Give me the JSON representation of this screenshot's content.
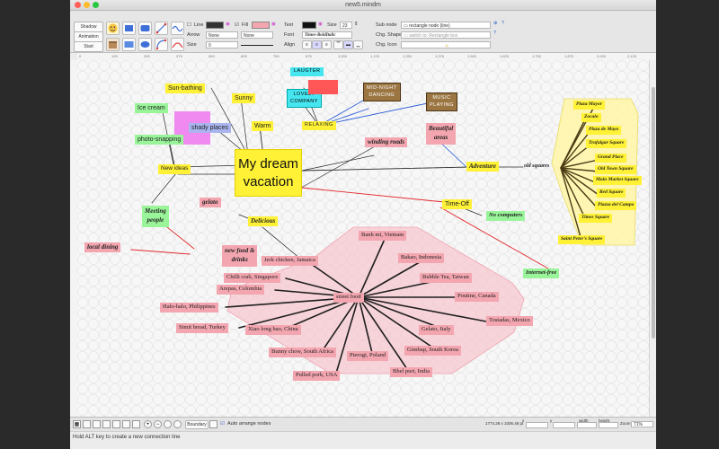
{
  "window": {
    "title": "new5.mindm"
  },
  "toolbar": {
    "buttons": {
      "shadow": "Shadow",
      "animation_setting": "Animation setting",
      "start_animation": "Start animation"
    },
    "line": {
      "line_label": "Line",
      "arrow_label": "Arrow",
      "arrow_start": "None",
      "arrow_end": "None",
      "size_label": "Size",
      "size_value": "0",
      "fill_label": "Fill",
      "line_color": "#333333",
      "fill_color": "#f4a6b0"
    },
    "text": {
      "text_label": "Text",
      "size_label": "Size",
      "size_value": "23",
      "font_label": "Font",
      "font_value": "Times-BoldItalic",
      "align_label": "Align",
      "text_color": "#111111"
    },
    "subnode": {
      "subnode_label": "Sub node",
      "subnode_value": "rectangle node (line)",
      "chg_shape_label": "Chg. Shape",
      "chg_shape_placeholder": "switch to: Rectangle box",
      "chg_icon_label": "Chg. Icon"
    }
  },
  "ruler": {
    "ticks": [
      "0",
      "125",
      "250",
      "375",
      "500",
      "625",
      "750",
      "875",
      "1,000",
      "1,125",
      "1,250",
      "1,375",
      "1,500",
      "1,625",
      "1,750",
      "1,875",
      "2,000",
      "2,125"
    ]
  },
  "colors": {
    "canvas": "#f7f7f7",
    "pink_node": "#f3a6b0",
    "yellow_node": "#fff135",
    "green_node": "#9af59a",
    "cyan_node": "#46e6f0",
    "brown_node": "#9b7642",
    "violet_node": "#f08af0",
    "red_line": "#e3262a",
    "blue_line": "#2a5bd7"
  },
  "nodes": {
    "center": "My dream\nvacation",
    "laugter": "LAUGTER",
    "lovely_company": "LOVELY\nCOMPANY",
    "midnight_dancing": "MID-NIGHT\nDANCING",
    "music_playing": "MUSIC\nPLAYING",
    "relaxing": "RELAXING",
    "sunbathing": "Sun-bathing",
    "sunny": "Sunny",
    "warm": "Warm",
    "ice_cream": "Ice cream",
    "shady_places": "shady places",
    "photo_snapping": "photo-snapping",
    "new_ideas": "New ideas",
    "meeting_people": "Meeting\npeople",
    "local_dining": "local dining",
    "new_food": "new food &\ndrinks",
    "gelato": "gelato",
    "delicious": "Delicious",
    "winding_roads": "winding roads",
    "beautiful_areas": "Beautiful\nareas",
    "adventure": "Adventure",
    "old_squares": "old squares",
    "time_off": "Time-Off",
    "no_computers": "No computers",
    "internet_free": "Internet-free",
    "street_food": "street food"
  },
  "squares": [
    "Plaza Mayor",
    "Zocalo",
    "Plaza de Mayo",
    "Trafalgar Square",
    "Grand Place",
    "Old Town Square",
    "Main Market Square",
    "Red Square",
    "Piazza del Campo",
    "Times Square",
    "Saint Peter's Square"
  ],
  "foods": [
    "Banh mi, Vietnam",
    "Bakao, Indonesia",
    "Bubble Tea, Taiwan",
    "Poutine, Canada",
    "Tostadas, Mexico",
    "Gelato, Italy",
    "Gimbap, South Korea",
    "Bhel puri, India",
    "Pierogi, Poland",
    "Pulled pork, USA",
    "Bunny chow, South Africa",
    "Xiao long bao, China",
    "Simit bread, Turkey",
    "Halo-halo, Philippines",
    "Arepas, Colombia",
    "Chilli crab, Singapore",
    "Jerk chicken, Jamaica"
  ],
  "bottom": {
    "boundary_label": "Boundary",
    "auto_arrange_label": "Auto arrange nodes",
    "coords": "1774.28 x 1006.48 pt",
    "x_label": "x",
    "y_label": "y",
    "width_label": "width",
    "height_label": "height",
    "zoom_label": "Zoom",
    "zoom_value": "71%"
  },
  "status": {
    "hint": "Hold ALT key to create a new connection line"
  }
}
